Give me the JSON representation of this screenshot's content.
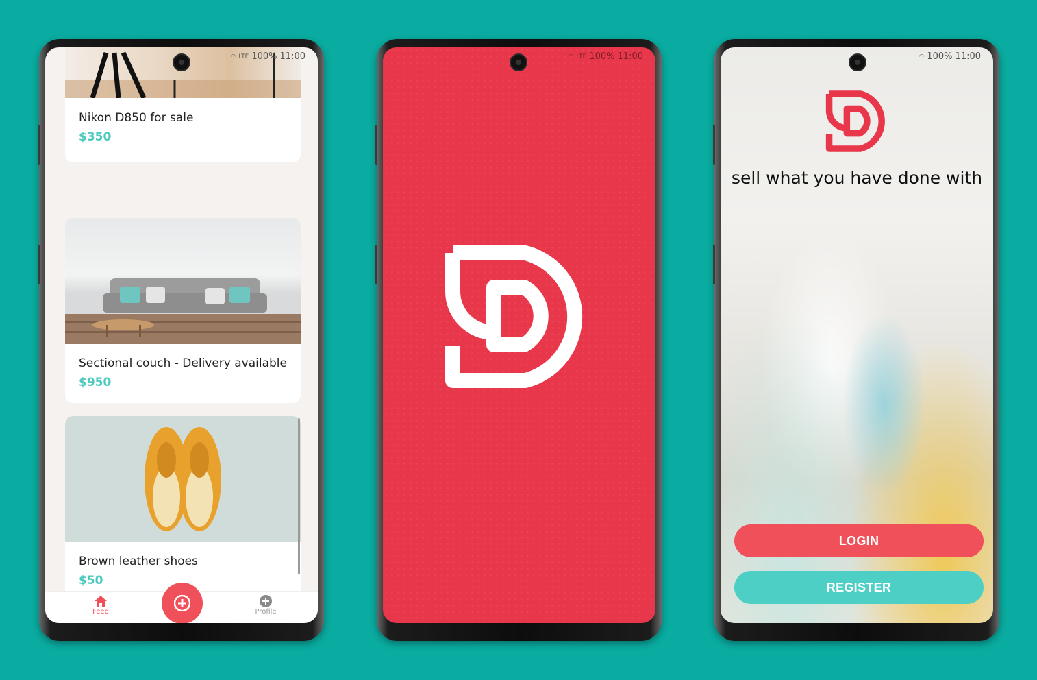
{
  "colors": {
    "background": "#0aaba0",
    "brand_red": "#e8374a",
    "accent_coral": "#f0505a",
    "accent_teal": "#4ec9c0"
  },
  "status_bar": {
    "network": "LTE",
    "battery": "100%",
    "time": "11:00"
  },
  "feed_screen": {
    "listings": [
      {
        "title": "Nikon D850 for sale",
        "price": "$350",
        "image": "camera-tripod-photo"
      },
      {
        "title": "Sectional couch - Delivery available",
        "price": "$950",
        "image": "grey-sofa-photo"
      },
      {
        "title": "Brown leather shoes",
        "price": "$50",
        "image": "yellow-shoes-photo"
      }
    ],
    "nav": {
      "feed_label": "Feed",
      "feed_icon": "home-icon",
      "add_icon": "plus-icon",
      "profile_label": "Profile",
      "profile_icon": "plus-circle-icon"
    }
  },
  "splash_screen": {
    "logo": "d-logo"
  },
  "welcome_screen": {
    "tagline": "sell what you have done with",
    "login_label": "LOGIN",
    "register_label": "REGISTER"
  }
}
